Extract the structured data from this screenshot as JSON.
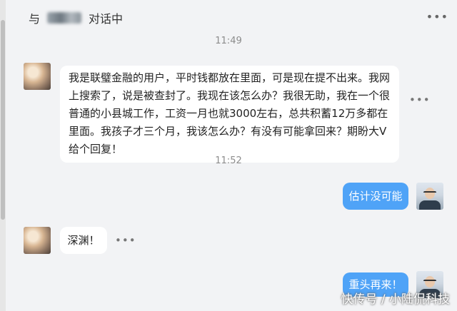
{
  "header": {
    "prefix": "与",
    "suffix": "对话中",
    "more": "•••"
  },
  "messages": [
    {
      "type": "time",
      "text": "11:49"
    },
    {
      "type": "incoming",
      "text": "我是联璧金融的用户，平时钱都放在里面，可是现在提不出来。我网上搜索了，说是被查封了。我现在该怎么办？我很无助，我在一个很普通的小县城工作，工资一月也就3000左右，总共积蓄12万多都在里面。我孩子才三个月，我该怎么办？有没有可能拿回来？期盼大V给个回复！"
    },
    {
      "type": "time",
      "text": "11:52"
    },
    {
      "type": "outgoing",
      "text": "估计没可能"
    },
    {
      "type": "incoming",
      "text": "深渊！"
    },
    {
      "type": "outgoing",
      "text": "重头再来！"
    }
  ],
  "message_actions": "•••",
  "watermark": "快传号 / 小陆侃科技"
}
